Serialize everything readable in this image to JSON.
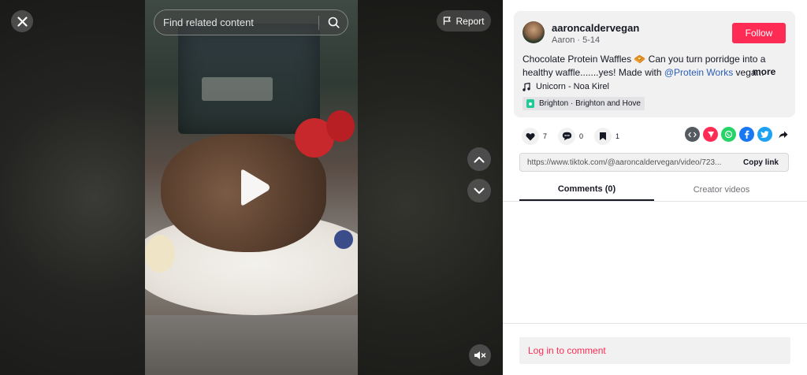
{
  "video": {
    "search_placeholder": "Find related content",
    "report_label": "Report"
  },
  "author": {
    "username": "aaroncaldervegan",
    "display_name": "Aaron",
    "date": "5-14",
    "follow_label": "Follow"
  },
  "description": {
    "text_before": "Chocolate Protein Waffles 🧇 Can you turn porridge into a healthy waffle.......yes! Made with ",
    "mention": "@Protein Works",
    "text_after": " vega...",
    "more_label": "more"
  },
  "music": {
    "title": "Unicorn - Noa Kirel"
  },
  "location": {
    "label": "Brighton · Brighton and Hove"
  },
  "stats": {
    "likes": "7",
    "comments": "0",
    "saves": "1"
  },
  "share_icons": [
    "embed-icon",
    "send-icon",
    "whatsapp-icon",
    "facebook-icon",
    "twitter-icon",
    "share-forward-icon"
  ],
  "link": {
    "url": "https://www.tiktok.com/@aaroncaldervegan/video/723...",
    "copy_label": "Copy link"
  },
  "tabs": [
    {
      "label": "Comments (0)",
      "active": true
    },
    {
      "label": "Creator videos",
      "active": false
    }
  ],
  "comments": {
    "login_prompt": "Log in to comment"
  },
  "colors": {
    "accent": "#fe2c55",
    "mention": "#2b5db9",
    "card_bg": "#f1f1f2"
  }
}
